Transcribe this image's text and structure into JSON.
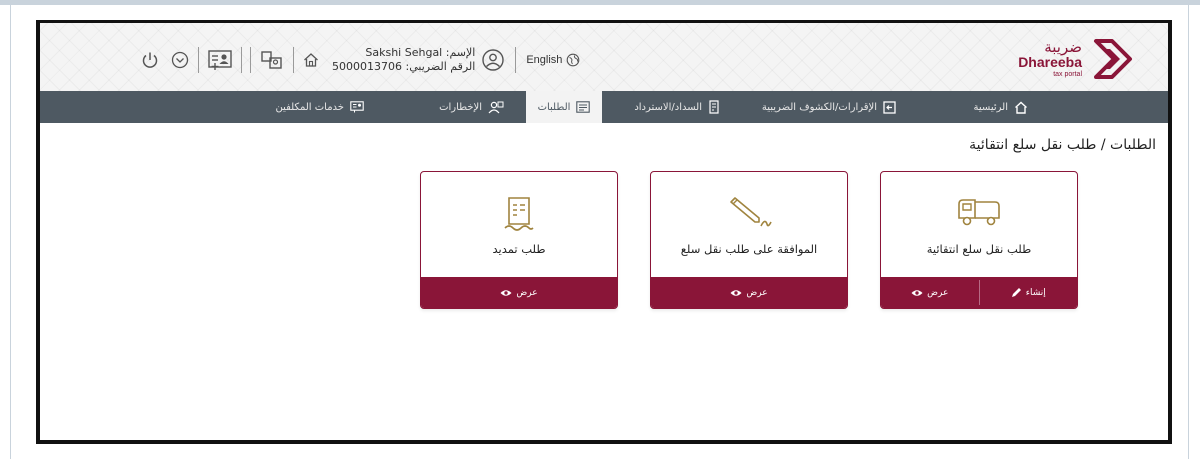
{
  "brand": {
    "name_ar": "ضريبة",
    "name_en": "Dhareeba",
    "tagline": "tax portal",
    "color": "#8a1538"
  },
  "header": {
    "user_name_label": "الإسم: Sakshi Sehgal",
    "tax_number_label": "الرقم الضريبي: 5000013706",
    "language_label": "English",
    "icons": [
      "power-icon",
      "chevron-down-icon",
      "id-card-icon",
      "users-switch-icon",
      "home-icon",
      "user-avatar-icon",
      "globe-icon"
    ]
  },
  "nav": {
    "items": [
      {
        "label": "الرئيسية",
        "icon": "home-icon"
      },
      {
        "label": "الإقرارات/الكشوف الضريبية",
        "icon": "return-icon"
      },
      {
        "label": "السداد/الاسترداد",
        "icon": "payment-icon"
      },
      {
        "label": "الطلبات",
        "icon": "requests-icon",
        "active": true
      },
      {
        "label": "الإخطارات",
        "icon": "notifications-icon"
      },
      {
        "label": "خدمات المكلفين",
        "icon": "services-icon"
      }
    ],
    "colors": {
      "bar": "#4e5962",
      "active": "#f3f3f3"
    }
  },
  "breadcrumb": "الطلبات / طلب نقل سلع انتقائية",
  "cards": [
    {
      "title": "طلب نقل سلع انتقائية",
      "icon": "truck-icon",
      "create_label": "إنشاء",
      "view_label": "عرض"
    },
    {
      "title": "الموافقة على طلب نقل سلع",
      "icon": "pen-icon",
      "view_label": "عرض"
    },
    {
      "title": "طلب تمديد",
      "icon": "document-icon",
      "view_label": "عرض"
    }
  ]
}
